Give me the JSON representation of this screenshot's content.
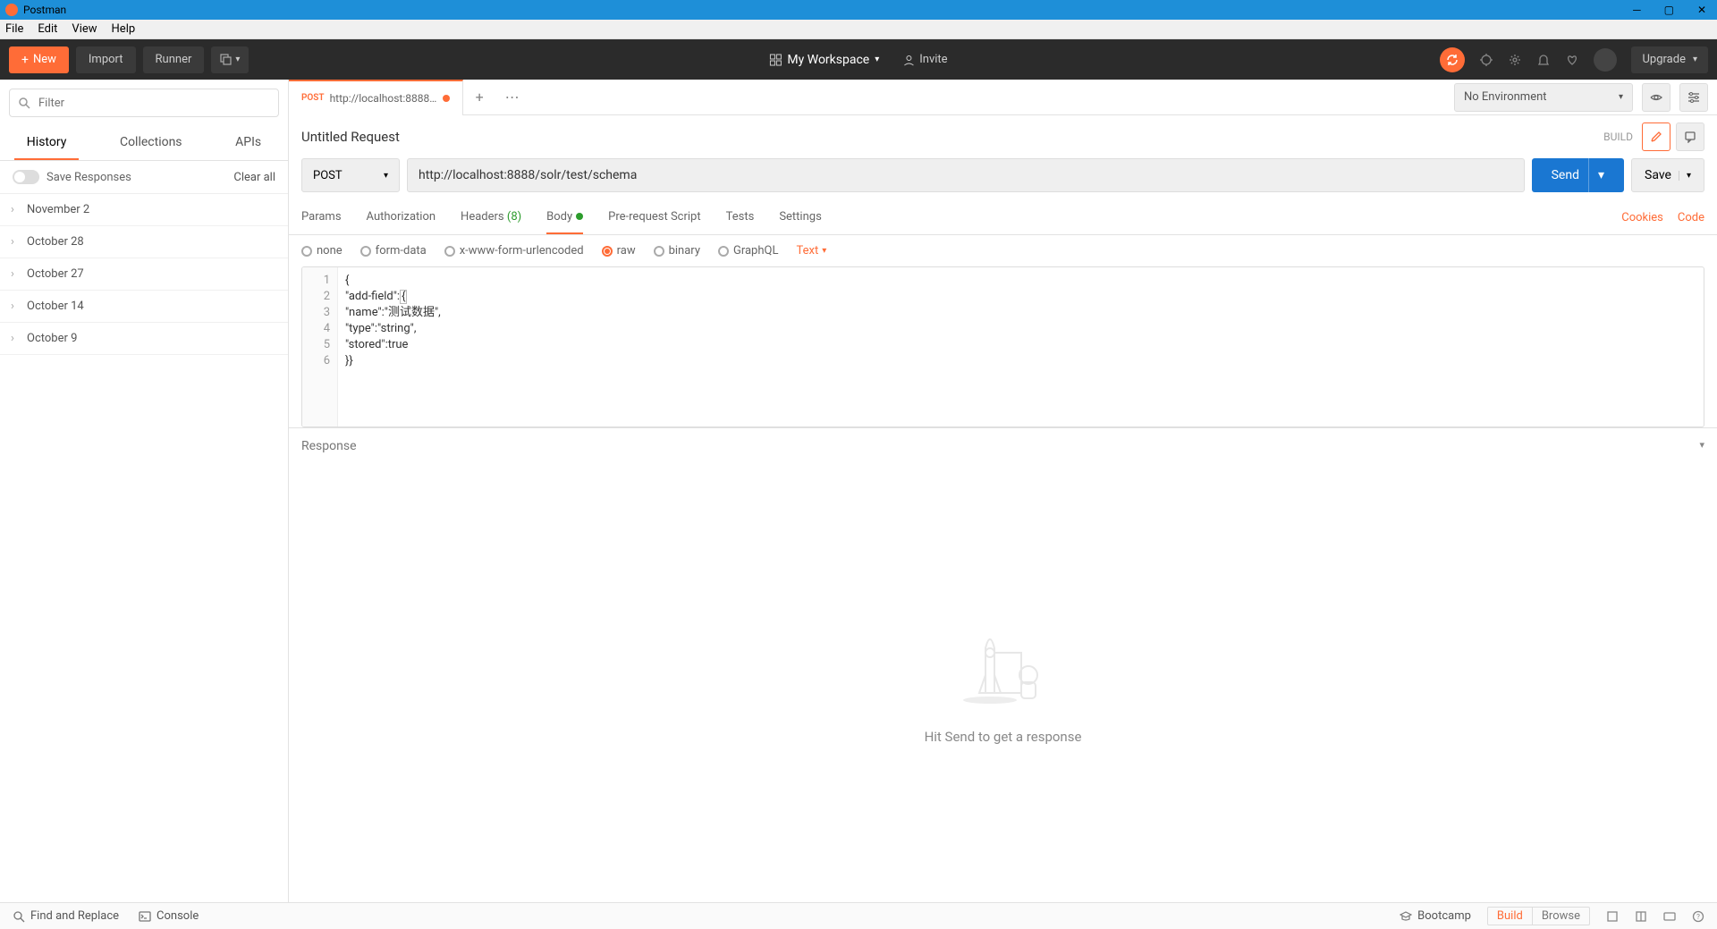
{
  "window": {
    "title": "Postman"
  },
  "menubar": {
    "items": [
      "File",
      "Edit",
      "View",
      "Help"
    ]
  },
  "toolbar": {
    "new": "New",
    "import": "Import",
    "runner": "Runner",
    "workspace": "My Workspace",
    "invite": "Invite",
    "upgrade": "Upgrade"
  },
  "sidebar": {
    "filter_placeholder": "Filter",
    "tabs": [
      "History",
      "Collections",
      "APIs"
    ],
    "save_responses": "Save Responses",
    "clear_all": "Clear all",
    "history": [
      "November 2",
      "October 28",
      "October 27",
      "October 14",
      "October 9"
    ]
  },
  "request_tab": {
    "method": "POST",
    "url_short": "http://localhost:8888/solr/test..."
  },
  "env": {
    "label": "No Environment"
  },
  "request": {
    "title": "Untitled Request",
    "build": "BUILD",
    "method": "POST",
    "url": "http://localhost:8888/solr/test/schema",
    "send": "Send",
    "save": "Save"
  },
  "param_tabs": {
    "params": "Params",
    "authorization": "Authorization",
    "headers": "Headers",
    "headers_count": "(8)",
    "body": "Body",
    "prerequest": "Pre-request Script",
    "tests": "Tests",
    "settings": "Settings",
    "cookies": "Cookies",
    "code": "Code"
  },
  "body_options": {
    "none": "none",
    "formdata": "form-data",
    "xwww": "x-www-form-urlencoded",
    "raw": "raw",
    "binary": "binary",
    "graphql": "GraphQL",
    "format": "Text"
  },
  "code_lines": [
    "{",
    "\"add-field\":{",
    "\"name\":\"测试数据\",",
    "\"type\":\"string\",",
    "\"stored\":true",
    "}}"
  ],
  "response": {
    "label": "Response",
    "empty_text": "Hit Send to get a response"
  },
  "statusbar": {
    "find": "Find and Replace",
    "console": "Console",
    "bootcamp": "Bootcamp",
    "build": "Build",
    "browse": "Browse"
  }
}
